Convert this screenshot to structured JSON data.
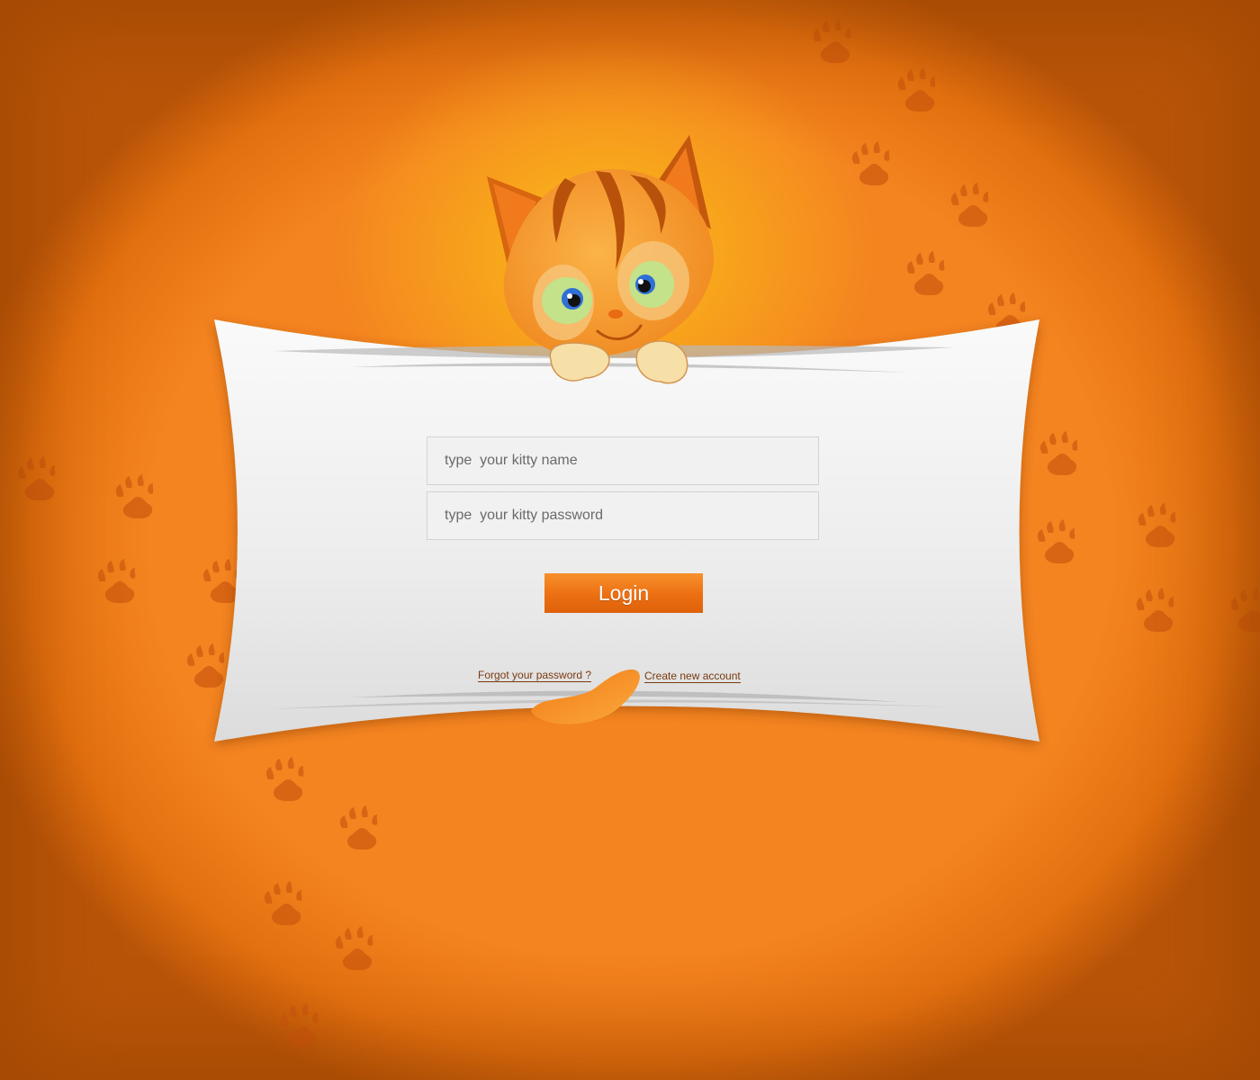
{
  "login_form": {
    "name_placeholder": "type  your kitty name",
    "password_placeholder": "type  your kitty password",
    "login_label": "Login",
    "forgot_password_label": "Forgot your password ?",
    "create_account_label": "Create new account"
  },
  "decoration": {
    "mascot": "cartoon-kitten-icon",
    "background_pattern": "paw-print-icon",
    "tail": "cat-tail-icon"
  },
  "colors": {
    "background": "#f2801c",
    "glow": "#fbc522",
    "card": "#f0f0f0",
    "button": "#ec6f12",
    "link": "#7a3a10"
  }
}
